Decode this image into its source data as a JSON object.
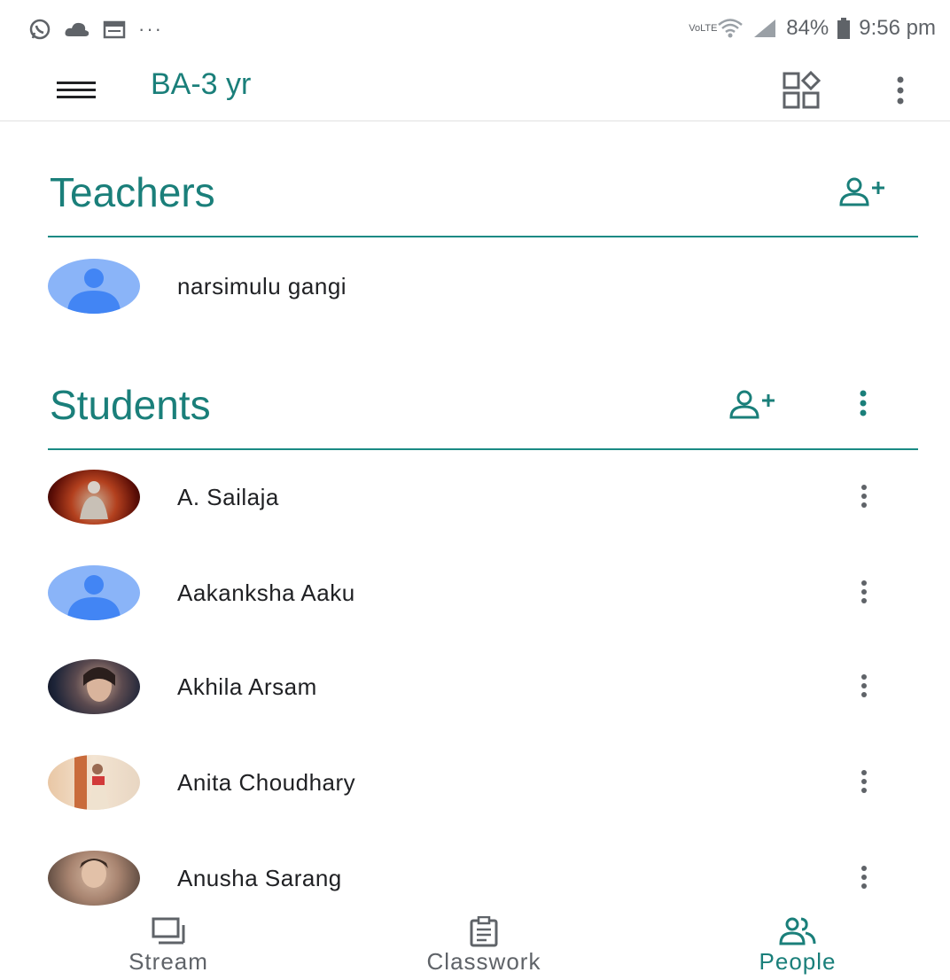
{
  "status": {
    "battery": "84%",
    "time": "9:56 pm",
    "network": "VoLTE"
  },
  "header": {
    "class_name": "BA-3 yr"
  },
  "teachers": {
    "title": "Teachers",
    "items": [
      {
        "name": "narsimulu gangi",
        "avatar": "default-avatar"
      }
    ]
  },
  "students": {
    "title": "Students",
    "items": [
      {
        "name": "A. Sailaja",
        "avatar": "photo-avatar"
      },
      {
        "name": "Aakanksha Aaku",
        "avatar": "default-avatar"
      },
      {
        "name": "Akhila Arsam",
        "avatar": "photo-avatar"
      },
      {
        "name": "Anita Choudhary",
        "avatar": "photo-avatar"
      },
      {
        "name": "Anusha Sarang",
        "avatar": "photo-avatar"
      }
    ]
  },
  "nav": {
    "tabs": [
      {
        "label": "Stream",
        "icon": "stream-icon"
      },
      {
        "label": "Classwork",
        "icon": "classwork-icon"
      },
      {
        "label": "People",
        "icon": "people-icon",
        "active": true
      }
    ]
  },
  "colors": {
    "accent": "#1a7f7a",
    "avatar_default": "#8ab4f8",
    "avatar_default_figure": "#4285f4"
  }
}
